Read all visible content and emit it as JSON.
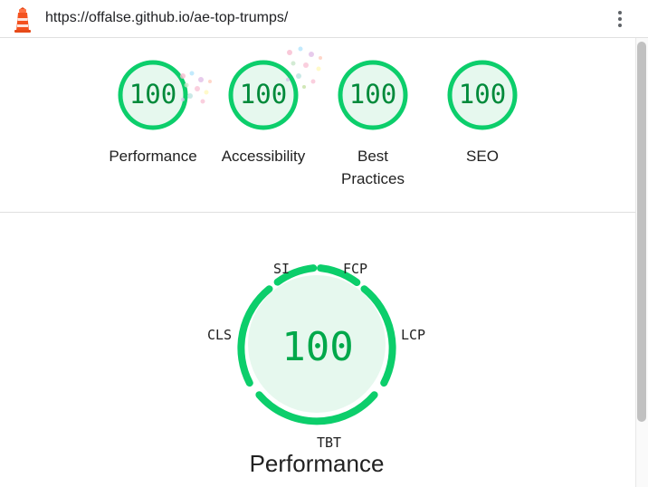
{
  "address_bar": {
    "url": "https://offalse.github.io/ae-top-trumps/",
    "menu_icon": "kebab-menu-icon",
    "site_icon": "lighthouse-icon"
  },
  "summary_gauges": [
    {
      "score": "100",
      "label": "Performance"
    },
    {
      "score": "100",
      "label": "Accessibility"
    },
    {
      "score": "100",
      "label": "Best Practices"
    },
    {
      "score": "100",
      "label": "SEO"
    }
  ],
  "performance_detail": {
    "score": "100",
    "title": "Performance",
    "metrics": {
      "si": "SI",
      "fcp": "FCP",
      "lcp": "LCP",
      "tbt": "TBT",
      "cls": "CLS"
    }
  },
  "colors": {
    "pass_green": "#0cce6b",
    "pass_fill": "#e6f8ee",
    "score_text": "#008a3a"
  }
}
